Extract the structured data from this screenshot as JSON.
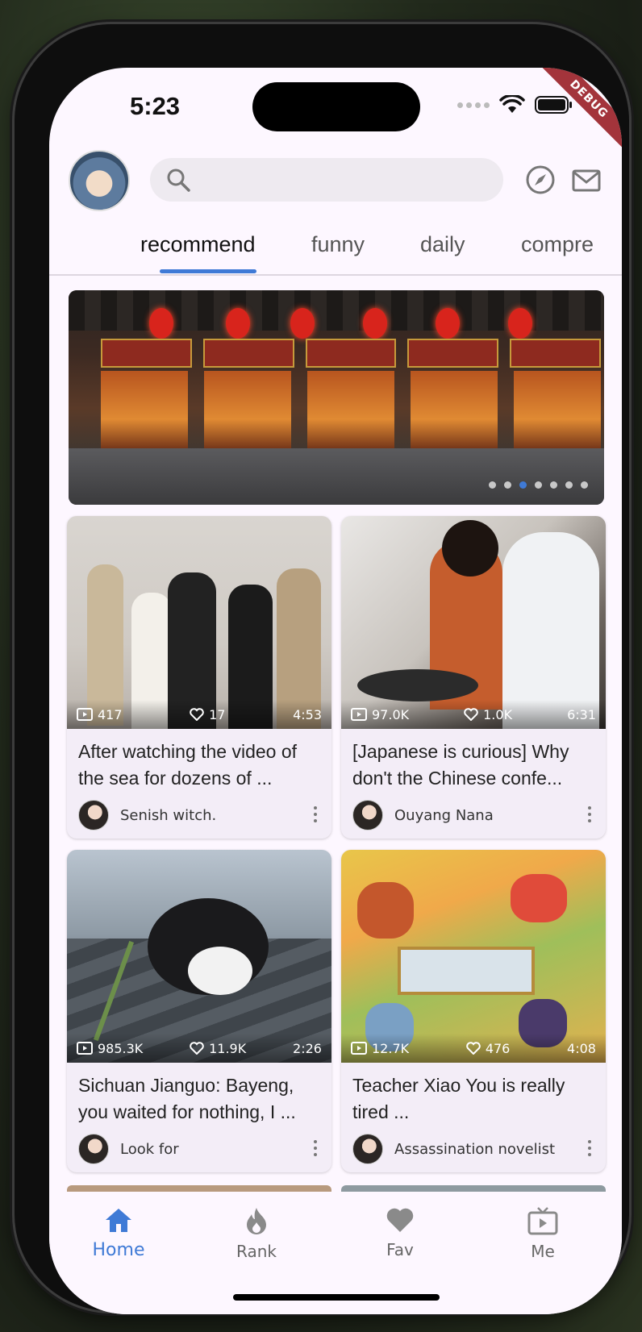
{
  "status_bar": {
    "time": "5:23",
    "debug_label": "DEBUG"
  },
  "search": {
    "placeholder": ""
  },
  "tabs": [
    {
      "label": "recommend",
      "active": true
    },
    {
      "label": "funny",
      "active": false
    },
    {
      "label": "daily",
      "active": false
    },
    {
      "label": "compre",
      "active": false
    }
  ],
  "banner": {
    "page_count": 7,
    "active_page": 3
  },
  "cards": [
    {
      "views": "417",
      "likes": "17",
      "duration": "4:53",
      "title": "After watching the video of the sea for dozens of ...",
      "author": "Senish witch."
    },
    {
      "views": "97.0K",
      "likes": "1.0K",
      "duration": "6:31",
      "title": "[Japanese is curious] Why don't the Chinese confe...",
      "author": "Ouyang Nana"
    },
    {
      "views": "985.3K",
      "likes": "11.9K",
      "duration": "2:26",
      "title": "Sichuan Jianguo: Bayeng, you waited for nothing, I ...",
      "author": "Look for"
    },
    {
      "views": "12.7K",
      "likes": "476",
      "duration": "4:08",
      "title": "Teacher Xiao You is really tired ...",
      "author": "Assassination novelist"
    }
  ],
  "nav": [
    {
      "label": "Home",
      "icon": "home-icon",
      "active": true
    },
    {
      "label": "Rank",
      "icon": "flame-icon",
      "active": false
    },
    {
      "label": "Fav",
      "icon": "heart-icon",
      "active": false
    },
    {
      "label": "Me",
      "icon": "tv-icon",
      "active": false
    }
  ],
  "colors": {
    "accent": "#3f7ad6",
    "background": "#fdf7ff",
    "card": "#f3edf7"
  }
}
